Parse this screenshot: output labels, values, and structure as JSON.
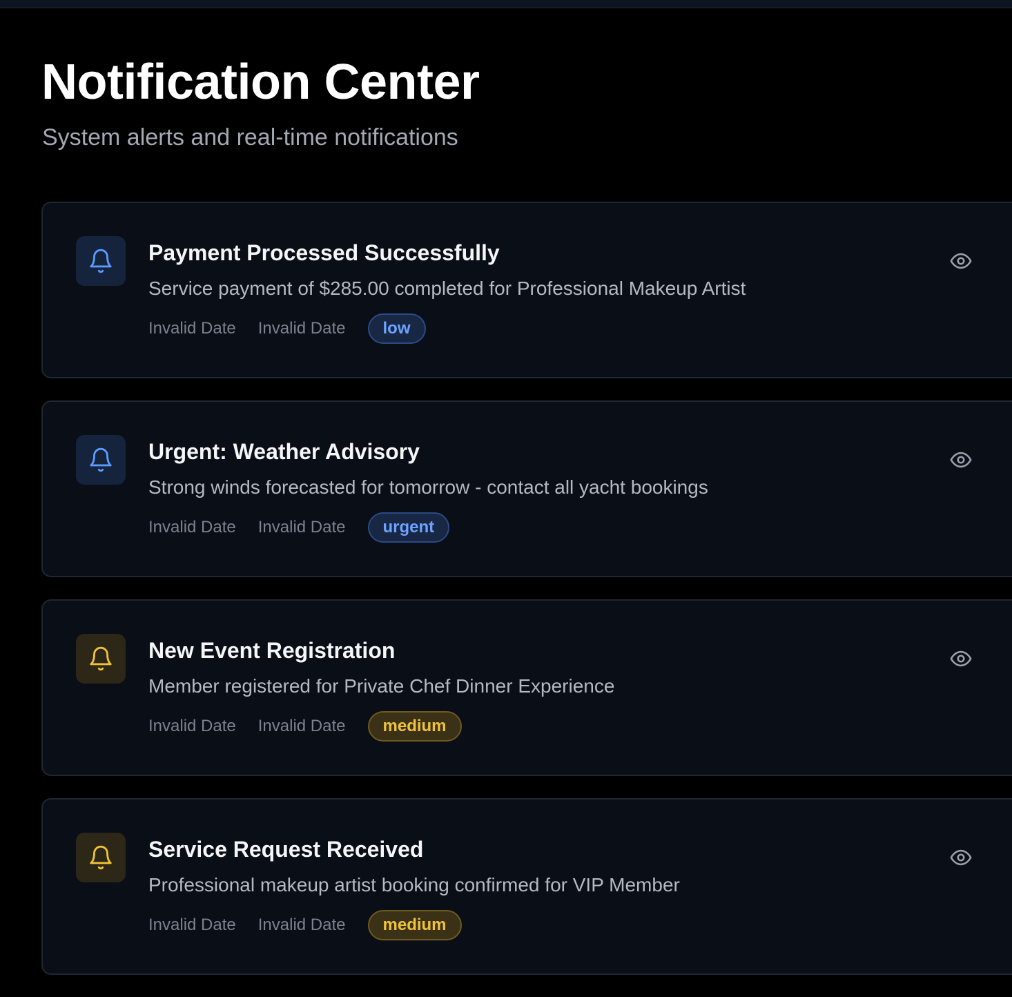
{
  "page": {
    "title": "Notification Center",
    "subtitle": "System alerts and real-time notifications"
  },
  "notifications": [
    {
      "title": "Payment Processed Successfully",
      "message": "Service payment of $285.00 completed for Professional Makeup Artist",
      "date": "Invalid Date",
      "time": "Invalid Date",
      "priority": "low",
      "color": "blue",
      "icon": "bell-icon",
      "action_icon": "eye-icon"
    },
    {
      "title": "Urgent: Weather Advisory",
      "message": "Strong winds forecasted for tomorrow - contact all yacht bookings",
      "date": "Invalid Date",
      "time": "Invalid Date",
      "priority": "urgent",
      "color": "blue",
      "icon": "bell-icon",
      "action_icon": "eye-icon"
    },
    {
      "title": "New Event Registration",
      "message": "Member registered for Private Chef Dinner Experience",
      "date": "Invalid Date",
      "time": "Invalid Date",
      "priority": "medium",
      "color": "yellow",
      "icon": "bell-icon",
      "action_icon": "eye-icon"
    },
    {
      "title": "Service Request Received",
      "message": "Professional makeup artist booking confirmed for VIP Member",
      "date": "Invalid Date",
      "time": "Invalid Date",
      "priority": "medium",
      "color": "yellow",
      "icon": "bell-icon",
      "action_icon": "eye-icon"
    }
  ],
  "colors": {
    "blue_icon": "#5b9bff",
    "yellow_icon": "#f0c23b",
    "eye_icon": "#9aa0aa"
  }
}
